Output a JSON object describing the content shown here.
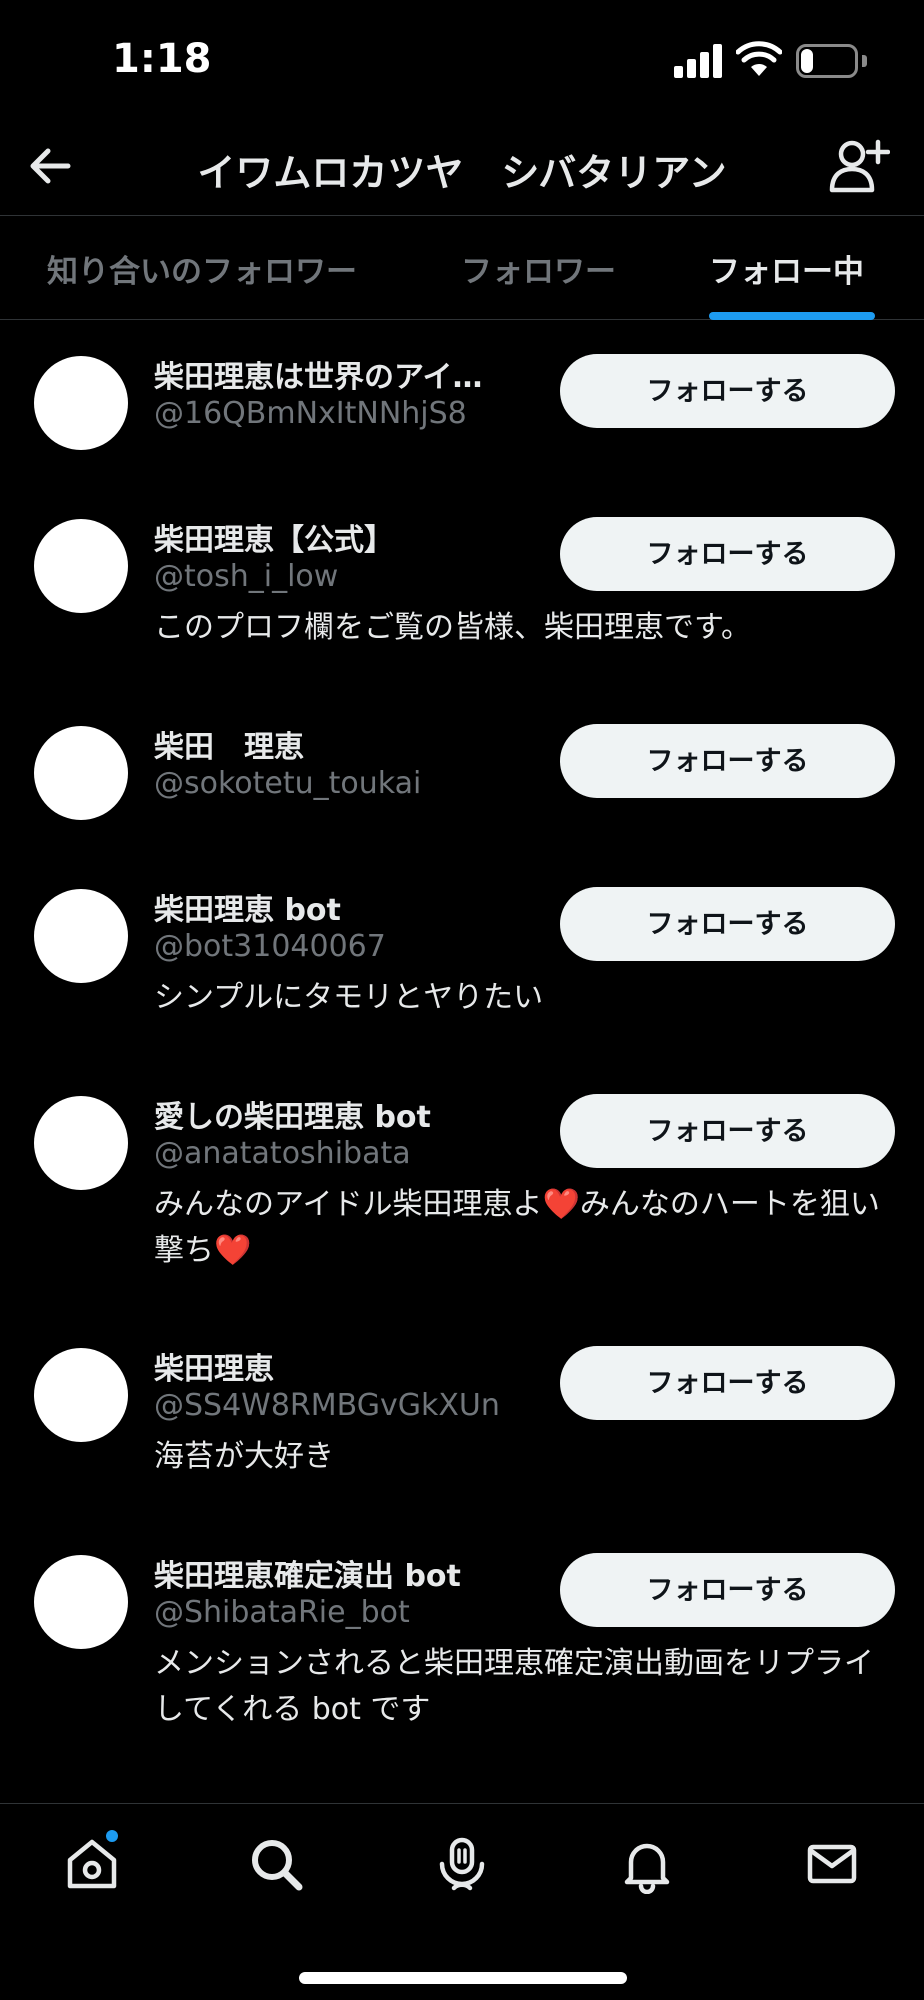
{
  "status_bar": {
    "time": "1:18",
    "battery": "24",
    "battery_level": 0.24
  },
  "nav": {
    "title": "イワムロカツヤ　シバタリアン",
    "back_icon": "arrow-left-icon",
    "add_icon": "person-add-icon"
  },
  "tabs": [
    {
      "label": "知り合いのフォロワー",
      "active": false
    },
    {
      "label": "フォロワー",
      "active": false
    },
    {
      "label": "フォロー中",
      "active": true
    }
  ],
  "users": [
    {
      "name": "柴田理恵は世界のアイ…",
      "handle": "@16QBmNxItNNhjS8",
      "bio": "",
      "follow_label": "フォローする"
    },
    {
      "name": "柴田理恵【公式】",
      "handle": "@tosh_i_low",
      "bio": "このプロフ欄をご覧の皆様、柴田理恵です。",
      "follow_label": "フォローする"
    },
    {
      "name": "柴田　理恵",
      "handle": "@sokotetu_toukai",
      "bio": "",
      "follow_label": "フォローする"
    },
    {
      "name": "柴田理恵 bot",
      "handle": "@bot31040067",
      "bio": "シンプルにタモリとヤりたい",
      "follow_label": "フォローする"
    },
    {
      "name": "愛しの柴田理恵 bot",
      "handle": "@anatatoshibata",
      "bio": "みんなのアイドル柴田理恵よ❤️みんなのハートを狙い撃ち❤️",
      "follow_label": "フォローする"
    },
    {
      "name": "柴田理恵",
      "handle": "@SS4W8RMBGvGkXUn",
      "bio": "海苔が大好き",
      "follow_label": "フォローする"
    },
    {
      "name": "柴田理恵確定演出 bot",
      "handle": "@ShibataRie_bot",
      "bio": "メンションされると柴田理恵確定演出動画をリプライしてくれる bot です",
      "follow_label": "フォローする"
    }
  ],
  "tabbar": {
    "icons": [
      "home-icon",
      "search-icon",
      "spaces-icon",
      "bell-icon",
      "mail-icon"
    ],
    "accent": "#1d9bf0"
  }
}
